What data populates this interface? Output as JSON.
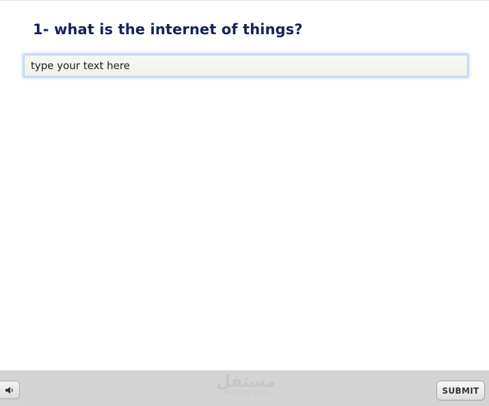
{
  "question": {
    "title": "1- what is the internet of things?"
  },
  "answer": {
    "placeholder": "type your text here",
    "value": ""
  },
  "bottom_bar": {
    "audio_icon": "speaker-icon",
    "watermark_logo": "مستقل",
    "watermark_url": "mostaql.com",
    "submit_label": "SUBMIT"
  },
  "colors": {
    "title": "#13235b",
    "bar": "#d3d3d3",
    "input_glow": "#78aae6"
  }
}
